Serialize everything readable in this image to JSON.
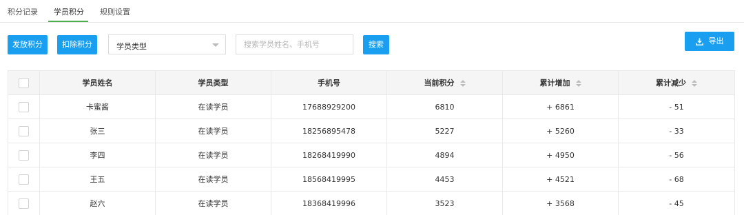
{
  "tabs": [
    {
      "label": "积分记录",
      "active": false
    },
    {
      "label": "学员积分",
      "active": true
    },
    {
      "label": "规则设置",
      "active": false
    }
  ],
  "toolbar": {
    "issue_label": "发放积分",
    "deduct_label": "扣除积分",
    "student_type_selected": "学员类型",
    "search_placeholder": "搜索学员姓名、手机号",
    "search_label": "搜索",
    "export_label": "导出",
    "export_icon": "download-icon"
  },
  "colors": {
    "primary": "#1a9ff0",
    "active_tab_underline": "#4cae4f",
    "header_bg": "#f5f5f5"
  },
  "table": {
    "headers": [
      "学员姓名",
      "学员类型",
      "手机号",
      "当前积分",
      "累计增加",
      "累计减少"
    ],
    "sortable": [
      false,
      false,
      false,
      true,
      true,
      true
    ],
    "rows": [
      [
        "卡蜜酱",
        "在读学员",
        "17688929200",
        "6810",
        "+ 6861",
        "- 51"
      ],
      [
        "张三",
        "在读学员",
        "18256895478",
        "5227",
        "+ 5260",
        "- 33"
      ],
      [
        "李四",
        "在读学员",
        "18268419990",
        "4894",
        "+ 4950",
        "- 56"
      ],
      [
        "王五",
        "在读学员",
        "18568419995",
        "4453",
        "+ 4521",
        "- 68"
      ],
      [
        "赵六",
        "在读学员",
        "18368419996",
        "3523",
        "+ 3568",
        "- 45"
      ]
    ]
  }
}
